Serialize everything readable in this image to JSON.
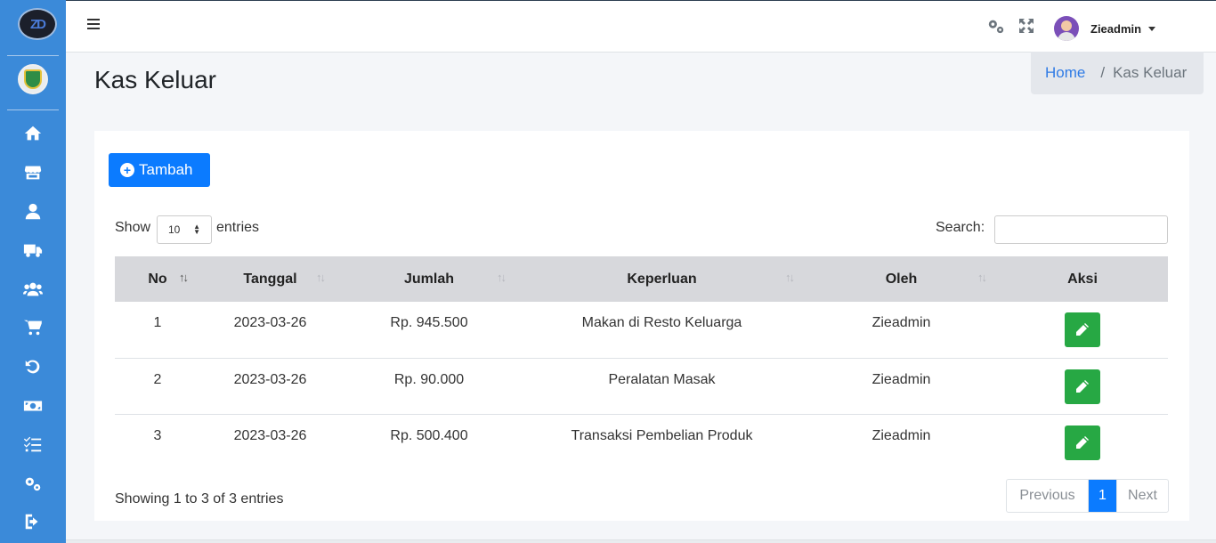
{
  "brand": {
    "logo_text": "ZD"
  },
  "sidebar": {
    "items": [
      {
        "icon": "home-icon"
      },
      {
        "icon": "store-icon"
      },
      {
        "icon": "user-icon"
      },
      {
        "icon": "truck-icon"
      },
      {
        "icon": "users-icon"
      },
      {
        "icon": "cart-icon"
      },
      {
        "icon": "undo-icon"
      },
      {
        "icon": "money-icon"
      },
      {
        "icon": "tasks-icon"
      },
      {
        "icon": "cogs-icon"
      },
      {
        "icon": "sign-out-icon"
      }
    ]
  },
  "topbar": {
    "user_name": "Zieadmin"
  },
  "page": {
    "title": "Kas Keluar",
    "breadcrumb_home": "Home",
    "breadcrumb_sep": "/",
    "breadcrumb_current": "Kas Keluar"
  },
  "toolbar": {
    "add_label": "Tambah",
    "add_icon": "+"
  },
  "datatable": {
    "show_label": "Show",
    "page_size": "10",
    "entries_label": "entries",
    "search_label": "Search:",
    "search_value": "",
    "columns": [
      "No",
      "Tanggal",
      "Jumlah",
      "Keperluan",
      "Oleh",
      "Aksi"
    ],
    "rows": [
      {
        "no": "1",
        "tanggal": "2023-03-26",
        "jumlah": "Rp. 945.500",
        "keperluan": "Makan di Resto Keluarga",
        "oleh": "Zieadmin"
      },
      {
        "no": "2",
        "tanggal": "2023-03-26",
        "jumlah": "Rp. 90.000",
        "keperluan": "Peralatan Masak",
        "oleh": "Zieadmin"
      },
      {
        "no": "3",
        "tanggal": "2023-03-26",
        "jumlah": "Rp. 500.400",
        "keperluan": "Transaksi Pembelian Produk",
        "oleh": "Zieadmin"
      }
    ],
    "info": "Showing 1 to 3 of 3 entries",
    "pager": {
      "prev": "Previous",
      "current": "1",
      "next": "Next"
    }
  },
  "colors": {
    "sidebar": "#3b8ad9",
    "primary": "#0b7bff",
    "success": "#27a844"
  }
}
